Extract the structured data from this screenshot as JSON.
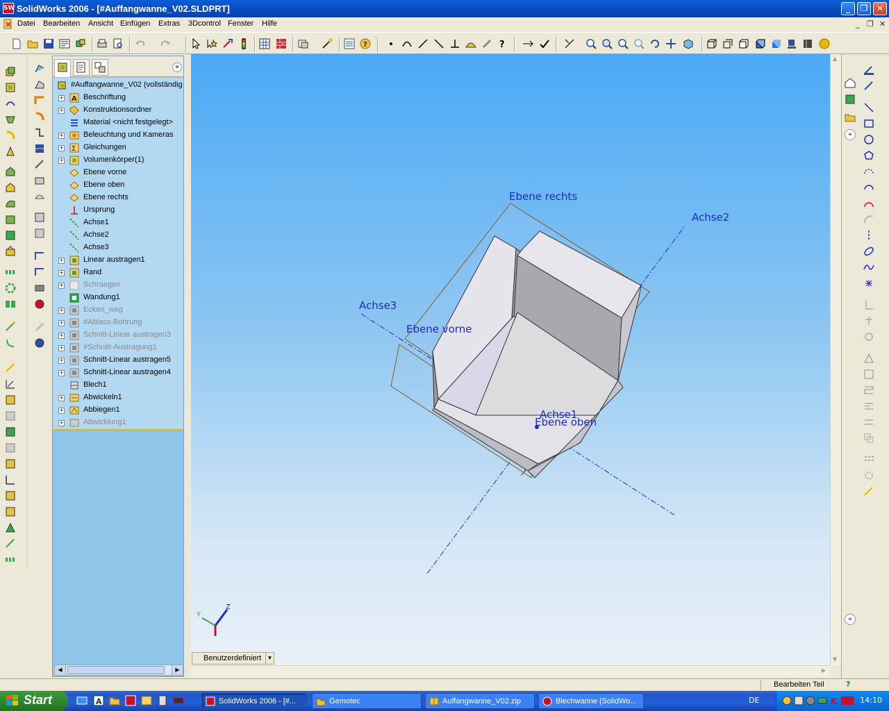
{
  "window": {
    "title": "SolidWorks 2006 - [#Auffangwanne_V02.SLDPRT]",
    "app_icon": "SW",
    "minimize": "_",
    "restore": "❐",
    "close": "✕"
  },
  "menu": {
    "items": [
      "Datei",
      "Bearbeiten",
      "Ansicht",
      "Einfügen",
      "Extras",
      "3Dcontrol",
      "Fenster",
      "Hilfe"
    ],
    "doc_controls": [
      "_",
      "❐",
      "✕"
    ]
  },
  "feature_tree": {
    "tabs": [
      "feature-manager-tab",
      "property-manager-tab",
      "configuration-manager-tab"
    ],
    "collapse": "»",
    "items": [
      {
        "label": "#Auffangwanne_V02  (vollständig",
        "icon": "part-icon",
        "expandable": false,
        "state": "normal"
      },
      {
        "label": "Beschriftung",
        "icon": "annotation-icon",
        "expandable": true,
        "state": "normal"
      },
      {
        "label": "Konstruktionsordner",
        "icon": "folder-icon",
        "expandable": true,
        "state": "normal"
      },
      {
        "label": "Material <nicht festgelegt>",
        "icon": "material-icon",
        "expandable": false,
        "state": "normal"
      },
      {
        "label": "Beleuchtung und Kameras",
        "icon": "lighting-icon",
        "expandable": true,
        "state": "normal"
      },
      {
        "label": "Gleichungen",
        "icon": "equation-icon",
        "expandable": true,
        "state": "normal"
      },
      {
        "label": "Volumenkörper(1)",
        "icon": "solid-body-icon",
        "expandable": true,
        "state": "normal"
      },
      {
        "label": "Ebene vorne",
        "icon": "plane-icon",
        "expandable": false,
        "state": "normal"
      },
      {
        "label": "Ebene oben",
        "icon": "plane-icon",
        "expandable": false,
        "state": "normal"
      },
      {
        "label": "Ebene rechts",
        "icon": "plane-icon",
        "expandable": false,
        "state": "normal"
      },
      {
        "label": "Ursprung",
        "icon": "origin-icon",
        "expandable": false,
        "state": "normal"
      },
      {
        "label": "Achse1",
        "icon": "axis-icon",
        "expandable": false,
        "state": "normal"
      },
      {
        "label": "Achse2",
        "icon": "axis-icon",
        "expandable": false,
        "state": "normal"
      },
      {
        "label": "Achse3",
        "icon": "axis-icon",
        "expandable": false,
        "state": "normal"
      },
      {
        "label": "Linear austragen1",
        "icon": "extrude-icon",
        "expandable": true,
        "state": "normal"
      },
      {
        "label": "Rand",
        "icon": "extrude-icon",
        "expandable": true,
        "state": "normal"
      },
      {
        "label": "Schraegen",
        "icon": "draft-icon",
        "expandable": true,
        "state": "dim"
      },
      {
        "label": "Wandung1",
        "icon": "shell-icon",
        "expandable": false,
        "state": "normal"
      },
      {
        "label": "Ecken_weg",
        "icon": "cut-icon",
        "expandable": true,
        "state": "dim"
      },
      {
        "label": "#Ablass-Bohrung",
        "icon": "cut-icon",
        "expandable": true,
        "state": "dim"
      },
      {
        "label": "Schnitt-Linear austragen3",
        "icon": "cut-icon",
        "expandable": true,
        "state": "dim"
      },
      {
        "label": "#Schnitt-Austragung1",
        "icon": "cut-icon",
        "expandable": true,
        "state": "dim"
      },
      {
        "label": "Schnitt-Linear austragen5",
        "icon": "cut-icon",
        "expandable": true,
        "state": "normal"
      },
      {
        "label": "Schnitt-Linear austragen4",
        "icon": "cut-icon",
        "expandable": true,
        "state": "normal"
      },
      {
        "label": "Blech1",
        "icon": "sheet-metal-icon",
        "expandable": false,
        "state": "normal"
      },
      {
        "label": "Abwickeln1",
        "icon": "unfold-icon",
        "expandable": true,
        "state": "normal"
      },
      {
        "label": "Abbiegen1",
        "icon": "fold-icon",
        "expandable": true,
        "state": "normal"
      },
      {
        "label": "Abwicklung1",
        "icon": "flat-pattern-icon",
        "expandable": true,
        "state": "dim"
      }
    ]
  },
  "viewport": {
    "labels": {
      "plane_right": "Ebene rechts",
      "plane_front": "Ebene vorne",
      "plane_top": "Ebene oben",
      "axis1": "Achse1",
      "axis2": "Achse2",
      "axis3": "Achse3"
    },
    "triad": {
      "x": "Y",
      "z": "Z"
    },
    "view_orientation": "Benutzerdefiniert",
    "colors": {
      "sky_top": "#4aa9f6",
      "sky_bottom": "#e9f0f8",
      "plane_edge": "#8a5a1a",
      "axis_line": "#1a2dbf"
    }
  },
  "statusbar": {
    "status": "Bearbeiten Teil",
    "help": "?"
  },
  "taskbar": {
    "start": "Start",
    "tasks": [
      {
        "label": "SolidWorks 2006 - [#...",
        "icon": "solidworks-icon",
        "active": true
      },
      {
        "label": "Gemotec",
        "icon": "folder-icon",
        "active": false
      },
      {
        "label": "Auffangwanne_V02.zip",
        "icon": "zip-icon",
        "active": false
      },
      {
        "label": "Blechwanne (SolidWo...",
        "icon": "browser-icon",
        "active": false
      }
    ],
    "language": "DE",
    "clock": "14:10"
  }
}
